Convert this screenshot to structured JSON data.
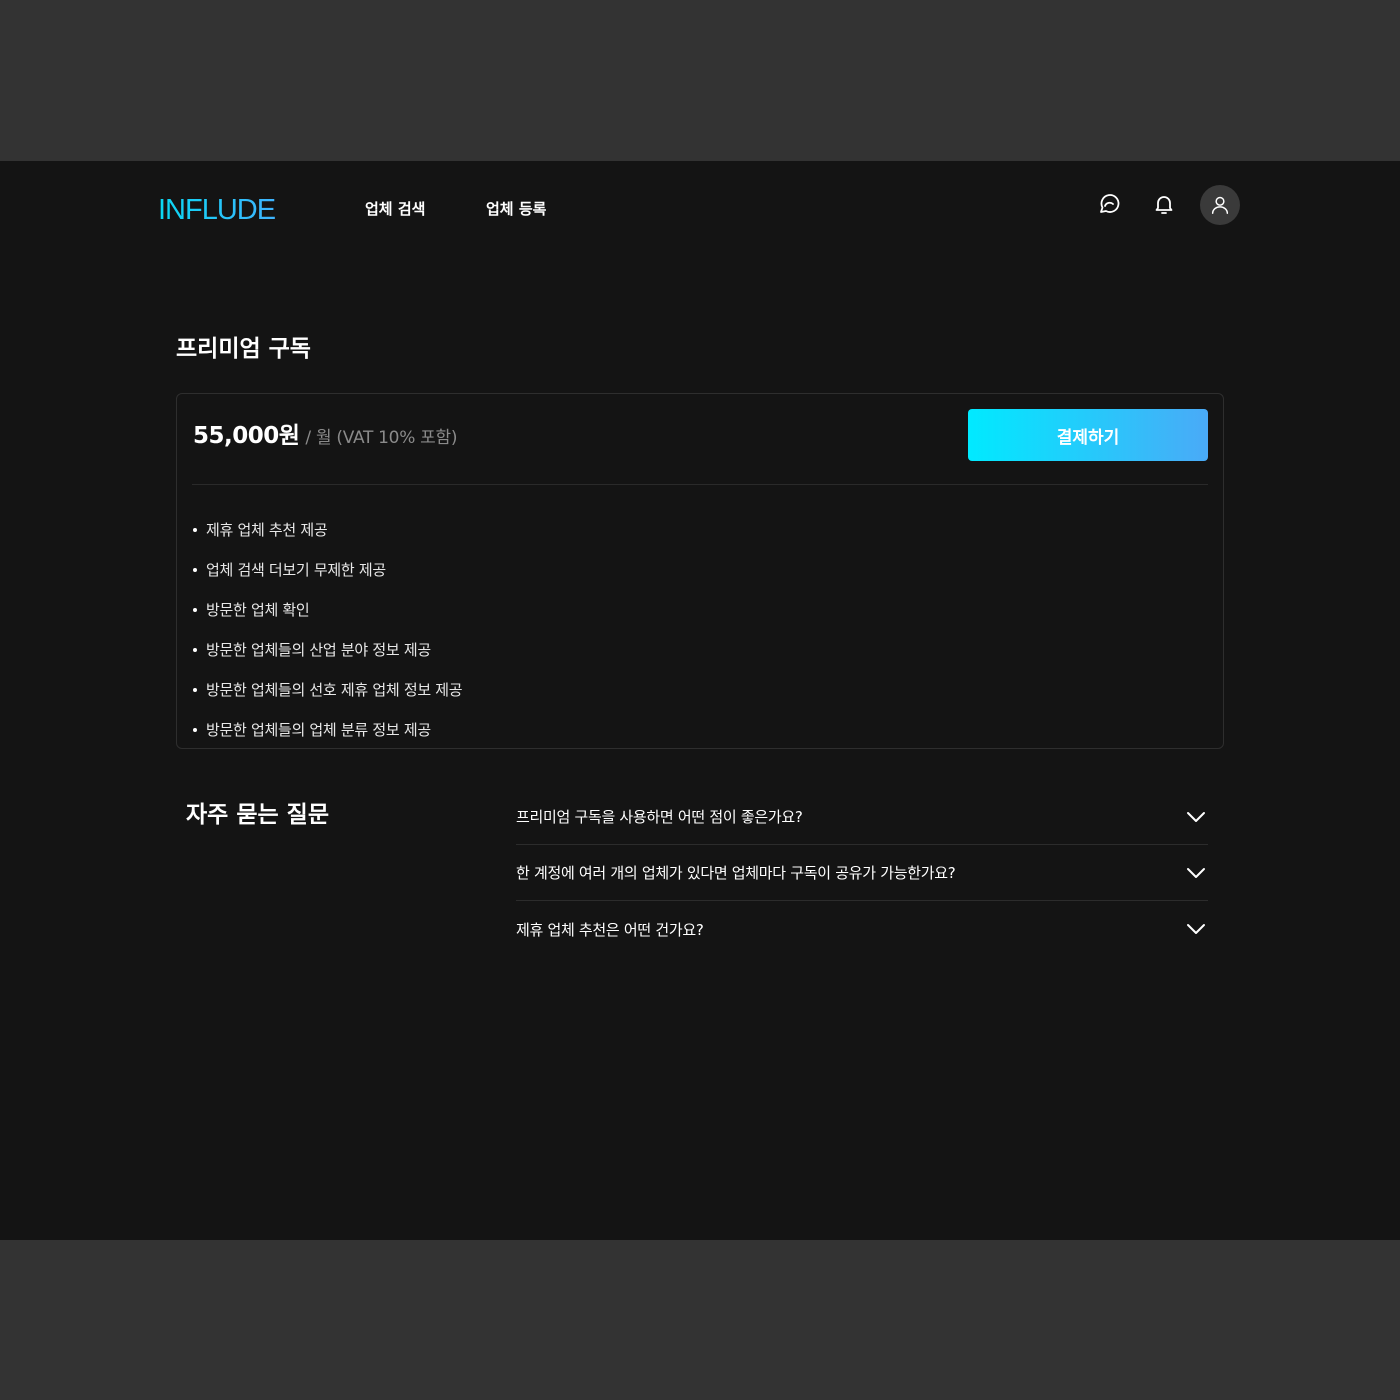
{
  "header": {
    "logo": "INFLUDE",
    "nav": [
      {
        "label": "업체 검색"
      },
      {
        "label": "업체 등록"
      }
    ],
    "icons": [
      "chat-icon",
      "bell-icon",
      "user-icon"
    ]
  },
  "plan": {
    "title": "프리미엄 구독",
    "price": "55,000원",
    "price_unit": "/ 월 (VAT 10% 포함)",
    "pay_label": "결제하기",
    "features": [
      "제휴 업체 추천 제공",
      "업체 검색 더보기 무제한 제공",
      "방문한 업체 확인",
      "방문한 업체들의 산업 분야 정보 제공",
      "방문한 업체들의 선호 제휴 업체 정보 제공",
      "방문한 업체들의 업체 분류 정보 제공"
    ]
  },
  "faq": {
    "title": "자주 묻는 질문",
    "items": [
      {
        "question": "프리미엄 구독을 사용하면 어떤 점이 좋은가요?"
      },
      {
        "question": "한 계정에 여러 개의 업체가 있다면 업체마다 구독이 공유가 가능한가요?"
      },
      {
        "question": "제휴 업체 추천은 어떤 건가요?"
      }
    ]
  },
  "colors": {
    "page_bg": "#333333",
    "app_bg": "#141414",
    "accent_start": "#00eaff",
    "accent_end": "#4aaaf7"
  }
}
